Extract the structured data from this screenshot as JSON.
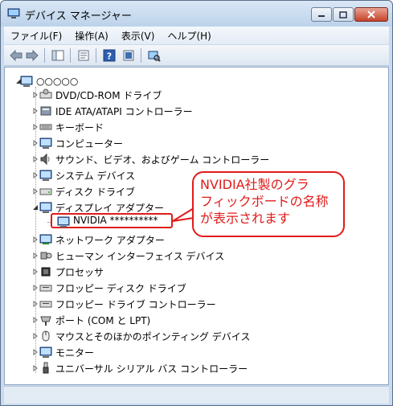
{
  "window": {
    "title": "デバイス マネージャー",
    "controls": {
      "minimize": "─",
      "maximize": "□",
      "close": "✕"
    }
  },
  "menubar": {
    "items": [
      "ファイル(F)",
      "操作(A)",
      "表示(V)",
      "ヘルプ(H)"
    ]
  },
  "toolbar": {
    "icons": [
      "back-arrow-icon",
      "forward-arrow-icon",
      "show-hide-tree-icon",
      "properties-icon",
      "help-icon",
      "scan-hardware-icon"
    ]
  },
  "tree": {
    "root": "○○○○○",
    "categories": [
      "DVD/CD-ROM ドライブ",
      "IDE ATA/ATAPI コントローラー",
      "キーボード",
      "コンピューター",
      "サウンド、ビデオ、およびゲーム コントローラー",
      "システム デバイス",
      "ディスク ドライブ",
      "ディスプレイ アダプター",
      "ネットワーク アダプター",
      "ヒューマン インターフェイス デバイス",
      "プロセッサ",
      "フロッピー ディスク ドライブ",
      "フロッピー ドライブ コントローラー",
      "ポート (COM と LPT)",
      "マウスとそのほかのポインティング デバイス",
      "モニター",
      "ユニバーサル シリアル バス コントローラー"
    ],
    "expanded_child": "NVIDIA **********"
  },
  "callout": {
    "lines": [
      "NVIDIA社製のグラ",
      "フィックボードの名称",
      "が表示されます"
    ]
  },
  "colors": {
    "callout_red": "#e11b1b",
    "title_bg": "#c9dbef"
  }
}
